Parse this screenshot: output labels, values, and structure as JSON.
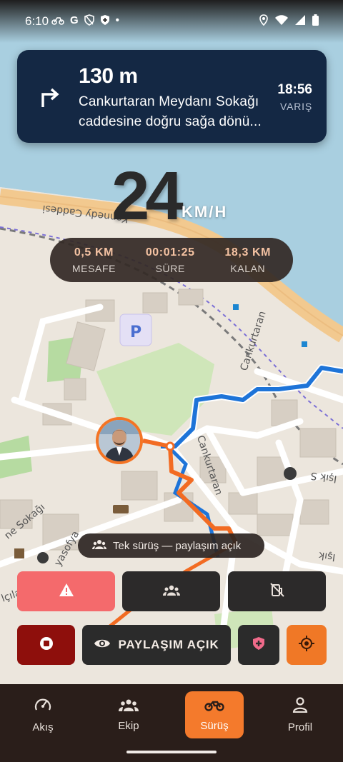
{
  "status_bar": {
    "time": "6:10",
    "left_icons": [
      "motorcycle-icon",
      "google-icon",
      "shield-off-icon",
      "shield-icon",
      "dot-icon"
    ],
    "right_icons": [
      "location-pin-icon",
      "wifi-icon",
      "signal-icon",
      "battery-icon"
    ]
  },
  "navigation": {
    "distance": "130 m",
    "instruction": "Cankurtaran Meydanı Sokağı caddesine doğru sağa dönü...",
    "eta_time": "18:56",
    "eta_label": "VARIŞ",
    "turn_icon": "turn-right-arrow-icon"
  },
  "speed": {
    "value": "24",
    "unit": "KM/H"
  },
  "stats": {
    "distance": {
      "value": "0,5 KM",
      "label": "MESAFE"
    },
    "duration": {
      "value": "00:01:25",
      "label": "SÜRE"
    },
    "remaining": {
      "value": "18,3 KM",
      "label": "KALAN"
    }
  },
  "map": {
    "street_labels": [
      "Kennedy Caddesi",
      "Cankurtaran",
      "Cankurtaran",
      "ne Sokağı",
      "yasofya",
      "Işık S",
      "Işık",
      "lçılar"
    ],
    "route_colors": {
      "planned": "#1e74d8",
      "ridden": "#f26b22"
    }
  },
  "share_chip": {
    "icon": "group-icon",
    "text": "Tek sürüş — paylaşım açık"
  },
  "actions": {
    "hazard_icon": "warning-triangle-icon",
    "group_icon": "group-icon",
    "no_fuel_icon": "fuel-off-icon",
    "stop_icon": "stop-icon",
    "share_label": "PAYLAŞIM AÇIK",
    "share_icon": "eye-icon",
    "sos_icon": "medical-shield-icon",
    "locate_icon": "crosshair-icon"
  },
  "bottom_nav": {
    "items": [
      {
        "label": "Akış",
        "icon": "speedometer-icon",
        "active": false
      },
      {
        "label": "Ekip",
        "icon": "group-icon",
        "active": false
      },
      {
        "label": "Sürüş",
        "icon": "motorcycle-icon",
        "active": true
      },
      {
        "label": "Profil",
        "icon": "person-icon",
        "active": false
      }
    ]
  },
  "colors": {
    "accent": "#f47a2c",
    "banner": "#142844",
    "hazard": "#f46a6c",
    "stop": "#8e0f0c",
    "nav_bg": "#2a1e1a"
  }
}
